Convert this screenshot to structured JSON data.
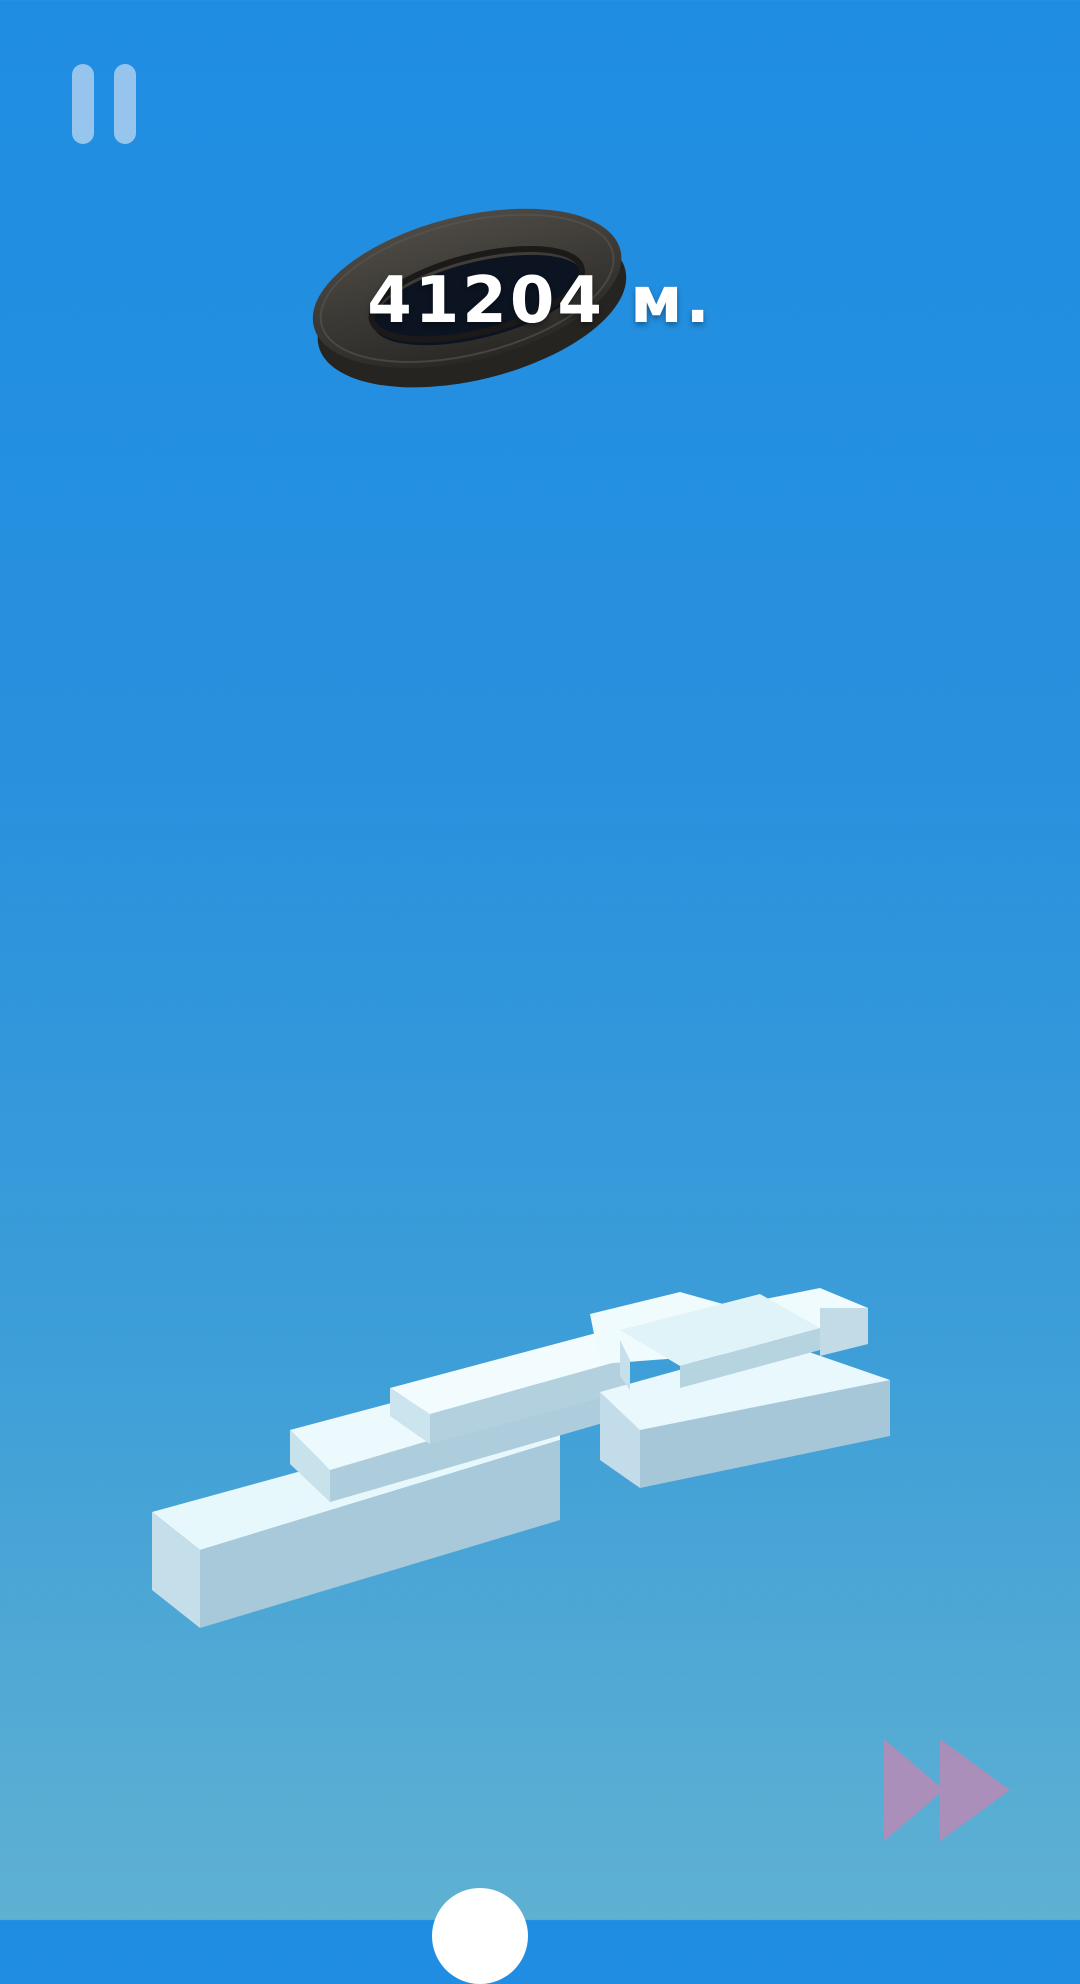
{
  "hud": {
    "score_text": "41204 м."
  },
  "controls": {
    "pause_icon": "pause-icon",
    "fast_forward_icon": "fast-forward-icon"
  },
  "scene": {
    "obstacle": "tire",
    "platform": "voxel-cloud",
    "player": "ball"
  },
  "colors": {
    "sky_top": "#1f8de2",
    "sky_bottom": "#5fb1d2",
    "pause_button": "#bed7f0",
    "fast_forward_button": "#b88ab5",
    "score_text": "#ffffff"
  }
}
